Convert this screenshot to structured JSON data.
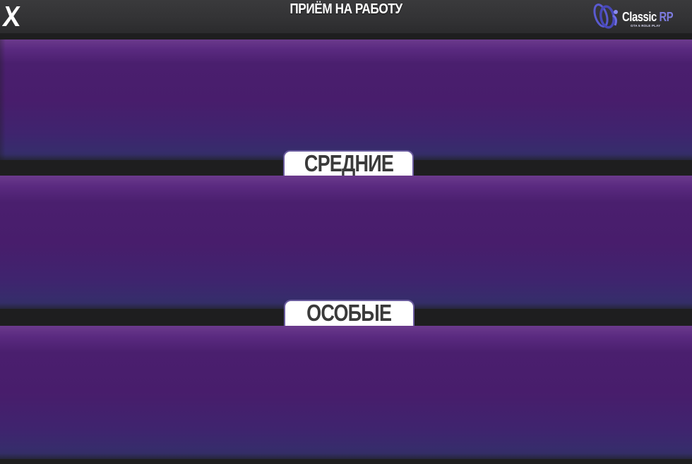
{
  "header": {
    "title": "ПРИЁМ НА РАБОТУ",
    "close_icon": "close-icon"
  },
  "logo": {
    "name": "Classic",
    "suffix": "RP",
    "tagline": "GTA 5 ROLE PLAY"
  },
  "categories": [
    {
      "label": ""
    },
    {
      "label": "СРЕДНИЕ"
    },
    {
      "label": "ОСОБЫЕ"
    }
  ],
  "colors": {
    "header_bg": "#333335",
    "page_bg": "#1e1e1f",
    "panel_purple": "#4a1f6e",
    "tab_bg": "#ffffff",
    "tab_text": "#3a3a3a",
    "logo_accent": "#7d7ce0"
  }
}
